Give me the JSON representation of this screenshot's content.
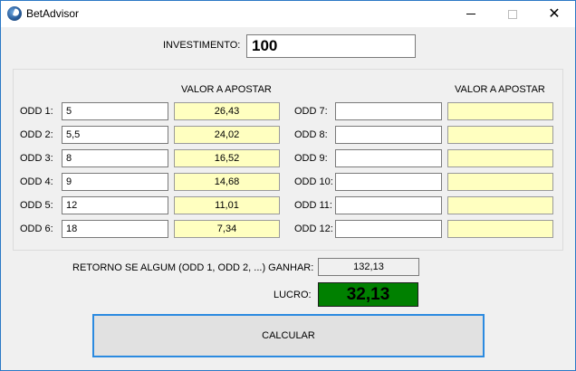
{
  "window": {
    "title": "BetAdvisor",
    "close_glyph": "✕"
  },
  "investimento": {
    "label": "INVESTIMENTO:",
    "value": "100"
  },
  "odds_left": {
    "header": "VALOR A APOSTAR",
    "rows": [
      {
        "label": "ODD 1:",
        "odd": "5",
        "valor": "26,43"
      },
      {
        "label": "ODD 2:",
        "odd": "5,5",
        "valor": "24,02"
      },
      {
        "label": "ODD 3:",
        "odd": "8",
        "valor": "16,52"
      },
      {
        "label": "ODD 4:",
        "odd": "9",
        "valor": "14,68"
      },
      {
        "label": "ODD 5:",
        "odd": "12",
        "valor": "11,01"
      },
      {
        "label": "ODD 6:",
        "odd": "18",
        "valor": "7,34"
      }
    ]
  },
  "odds_right": {
    "header": "VALOR A APOSTAR",
    "rows": [
      {
        "label": "ODD 7:",
        "odd": "",
        "valor": ""
      },
      {
        "label": "ODD 8:",
        "odd": "",
        "valor": ""
      },
      {
        "label": "ODD 9:",
        "odd": "",
        "valor": ""
      },
      {
        "label": "ODD 10:",
        "odd": "",
        "valor": ""
      },
      {
        "label": "ODD 11:",
        "odd": "",
        "valor": ""
      },
      {
        "label": "ODD 12:",
        "odd": "",
        "valor": ""
      }
    ]
  },
  "retorno": {
    "label": "RETORNO SE ALGUM (ODD 1, ODD 2, ...) GANHAR:",
    "value": "132,13"
  },
  "lucro": {
    "label": "LUCRO:",
    "value": "32,13",
    "color": "#008000"
  },
  "calcular_button": {
    "label": "CALCULAR"
  },
  "colors": {
    "output_bg": "#ffffc0",
    "accent_border": "#2b8ae0"
  }
}
